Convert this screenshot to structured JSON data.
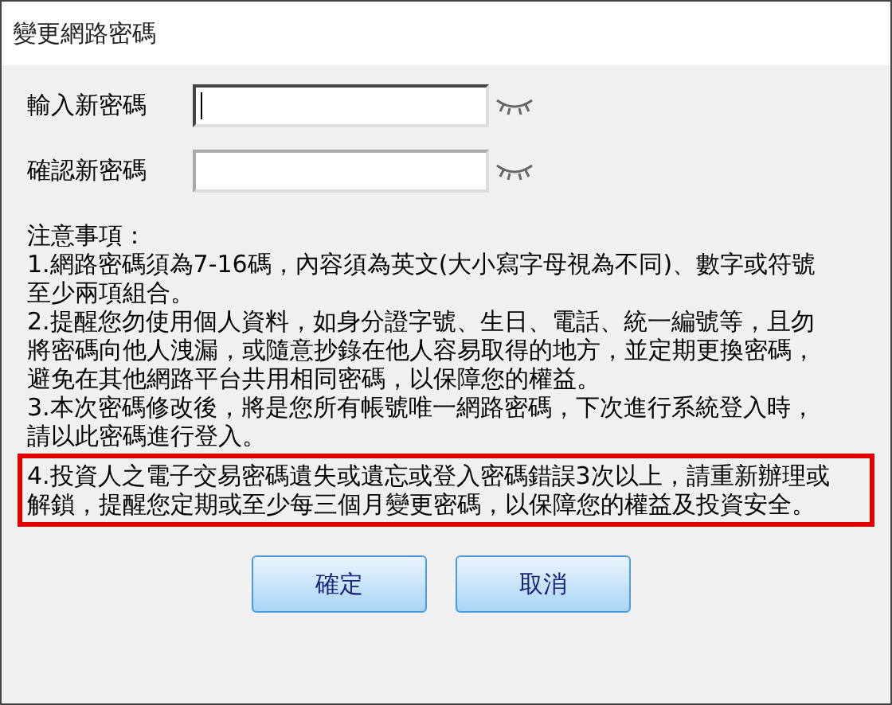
{
  "window": {
    "title": "變更網路密碼"
  },
  "fields": [
    {
      "label": "輸入新密碼",
      "focused": true
    },
    {
      "label": "確認新密碼",
      "focused": false
    }
  ],
  "notes": {
    "heading": "注意事項：",
    "items": [
      {
        "text": "1.網路密碼須為7-16碼，內容須為英文(大小寫字母視為不同)、數字或符號至少兩項組合。",
        "highlighted": false
      },
      {
        "text": "2.提醒您勿使用個人資料，如身分證字號、生日、電話、統一編號等，且勿將密碼向他人洩漏，或隨意抄錄在他人容易取得的地方，並定期更換密碼，避免在其他網路平台共用相同密碼，以保障您的權益。",
        "highlighted": false
      },
      {
        "text": "3.本次密碼修改後，將是您所有帳號唯一網路密碼，下次進行系統登入時，請以此密碼進行登入。",
        "highlighted": false
      },
      {
        "text": "4.投資人之電子交易密碼遺失或遺忘或登入密碼錯誤3次以上，請重新辦理或解鎖，提醒您定期或至少每三個月變更密碼，以保障您的權益及投資安全。",
        "highlighted": true
      }
    ]
  },
  "buttons": [
    "確定",
    "取消"
  ]
}
